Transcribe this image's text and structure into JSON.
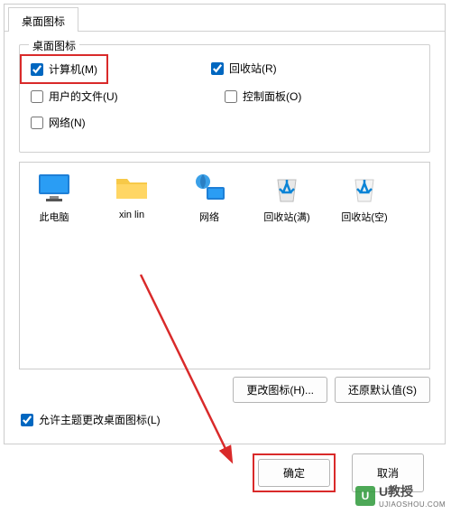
{
  "tab": {
    "label": "桌面图标"
  },
  "group": {
    "title": "桌面图标",
    "checks": {
      "computer": {
        "label": "计算机(M)",
        "checked": true
      },
      "recycle": {
        "label": "回收站(R)",
        "checked": true
      },
      "userfiles": {
        "label": "用户的文件(U)",
        "checked": false
      },
      "ctrlpanel": {
        "label": "控制面板(O)",
        "checked": false
      },
      "network": {
        "label": "网络(N)",
        "checked": false
      }
    }
  },
  "icons": {
    "thispc": "此电脑",
    "xinlin": "xin lin",
    "network": "网络",
    "recyclefull": "回收站(满)",
    "recycleempty": "回收站(空)"
  },
  "buttons": {
    "change": "更改图标(H)...",
    "restore": "还原默认值(S)",
    "themeCheck": "允许主题更改桌面图标(L)",
    "ok": "确定",
    "cancel": "取消"
  },
  "themeChecked": true,
  "watermark": {
    "brand": "U教授",
    "sub": "UJIAOSHOU.COM"
  }
}
